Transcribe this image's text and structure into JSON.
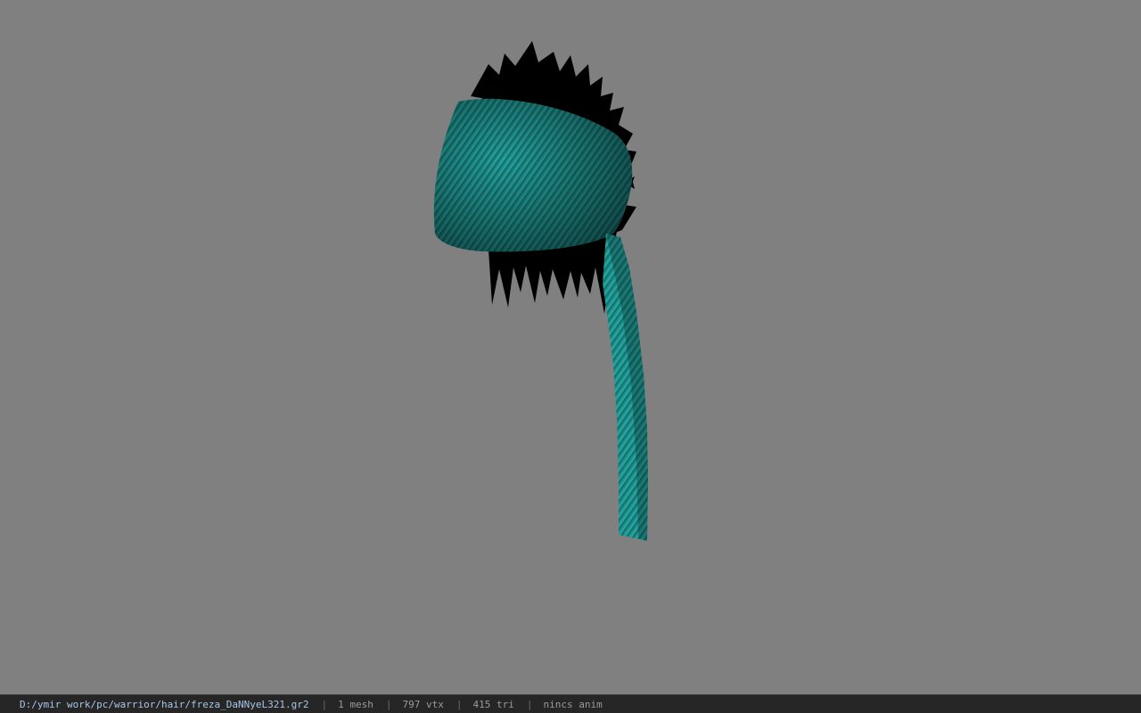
{
  "viewport": {
    "background": "#808080",
    "model": {
      "name": "hair-model",
      "cloth_color": "#1f8f8a",
      "spike_color": "#000000"
    }
  },
  "statusbar": {
    "file_path": "D:/ymir work/pc/warrior/hair/freza_DaNNyeL321.gr2",
    "separator": "|",
    "mesh": "1 mesh",
    "vertices": "797 vtx",
    "triangles": "415 tri",
    "anim": "nincs anim"
  }
}
